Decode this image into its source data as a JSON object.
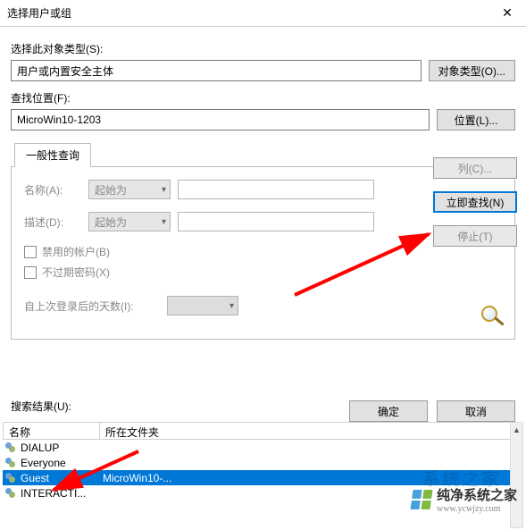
{
  "window": {
    "title": "选择用户或组"
  },
  "fields": {
    "object_type_label": "选择此对象类型(S):",
    "object_type_value": "用户或内置安全主体",
    "object_type_button": "对象类型(O)...",
    "location_label": "查找位置(F):",
    "location_value": "MicroWin10-1203",
    "location_button": "位置(L)..."
  },
  "tab": {
    "label": "一般性查询",
    "name_label": "名称(A):",
    "name_combo": "起始为",
    "desc_label": "描述(D):",
    "desc_combo": "起始为",
    "chk_disabled": "禁用的帐户(B)",
    "chk_noexpire": "不过期密码(X)",
    "days_label": "自上次登录后的天数(I):"
  },
  "side_buttons": {
    "columns": "列(C)...",
    "find_now": "立即查找(N)",
    "stop": "停止(T)"
  },
  "bottom_buttons": {
    "ok": "确定",
    "cancel": "取消"
  },
  "results": {
    "label": "搜索结果(U):",
    "col_name": "名称",
    "col_folder": "所在文件夹",
    "items": [
      {
        "name": "DIALUP",
        "folder": ""
      },
      {
        "name": "Everyone",
        "folder": ""
      },
      {
        "name": "Guest",
        "folder": "MicroWin10-...",
        "selected": true
      },
      {
        "name": "INTERACTI...",
        "folder": ""
      }
    ]
  },
  "watermark": {
    "ghost": "系统之家",
    "brand": "纯净系统之家",
    "url": "www.ycwjzy.com"
  }
}
